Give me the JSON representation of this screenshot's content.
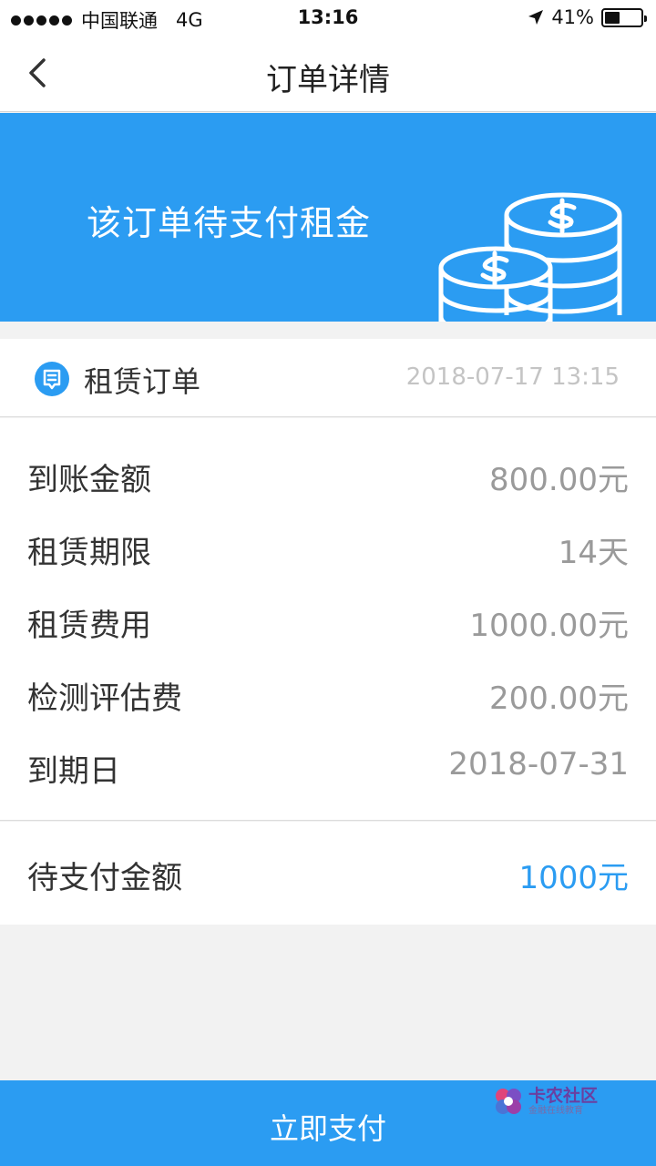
{
  "status_bar": {
    "carrier": "中国联通",
    "network": "4G",
    "time": "13:16",
    "battery": "41%",
    "battery_level": 0.41
  },
  "nav": {
    "title": "订单详情",
    "back_icon": "chevron-left-icon"
  },
  "banner": {
    "text": "该订单待支付租金",
    "icon": "coin-stack-icon",
    "background": "#2b9cf2"
  },
  "order": {
    "type": "租赁订单",
    "created_at": "2018-07-17 13:15",
    "icon": "message-icon"
  },
  "details": [
    {
      "label": "到账金额",
      "value": "800.00元"
    },
    {
      "label": "租赁期限",
      "value": "14天"
    },
    {
      "label": "租赁费用",
      "value": "1000.00元"
    },
    {
      "label": "检测评估费",
      "value": "200.00元"
    },
    {
      "label": "到期日",
      "value": "2018-07-31"
    }
  ],
  "pending": {
    "label": "待支付金额",
    "value": "1000元",
    "color": "#2b9cf2"
  },
  "pay_button": {
    "label": "立即支付"
  },
  "watermark": {
    "title": "卡农社区",
    "subtitle": "金融在线教育"
  }
}
